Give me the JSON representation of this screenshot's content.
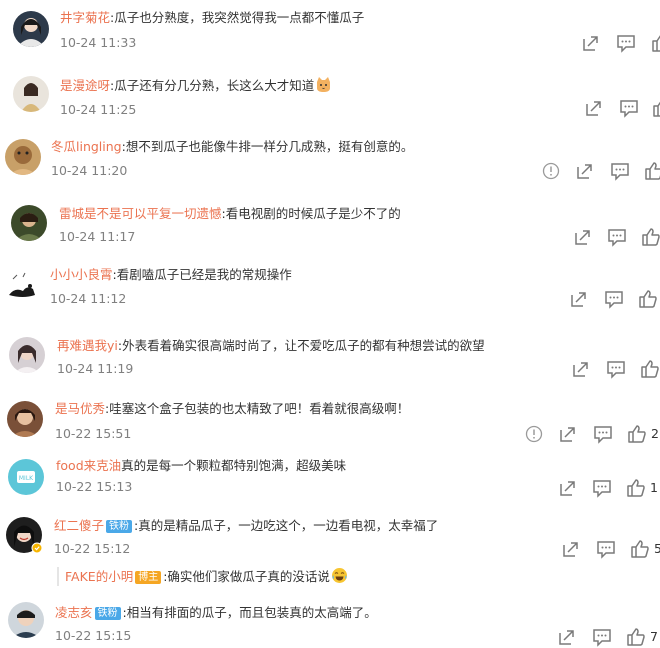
{
  "comments": [
    {
      "username": "井字菊花",
      "text": ":瓜子也分熟度，我突然觉得我一点都不懂瓜子",
      "time": "10-24 11:33",
      "emoji": ""
    },
    {
      "username": "是漫途呀",
      "text": ":瓜子还有分几分熟，长这么大才知道",
      "time": "10-24 11:25",
      "emoji": "cat-emoji"
    },
    {
      "username": "冬瓜lingling",
      "text": ":想不到瓜子也能像牛排一样分几成熟，挺有创意的。",
      "time": "10-24 11:20",
      "emoji": ""
    },
    {
      "username": "雷城是不是可以平复一切遗憾",
      "text": ":看电视剧的时候瓜子是少不了的",
      "time": "10-24 11:17",
      "emoji": ""
    },
    {
      "username": "小小小良霄",
      "text": ":看剧嗑瓜子已经是我的常规操作",
      "time": "10-24 11:12",
      "emoji": ""
    },
    {
      "username": "再难遇我yi",
      "text": ":外表看着确实很高端时尚了，让不爱吃瓜子的都有种想尝试的欲望",
      "time": "10-24 11:19",
      "emoji": ""
    },
    {
      "username": "是马优秀",
      "text": ":哇塞这个盒子包装的也太精致了吧！看着就很高级啊！",
      "time": "10-22 15:51",
      "likes": "2"
    },
    {
      "username": "food来克油",
      "text": "真的是每一个颗粒都特别饱满，超级美味",
      "time": "10-22 15:13",
      "likes": "1"
    },
    {
      "username": "红二傻子",
      "badge": "铁粉",
      "text": ":真的是精品瓜子，一边吃这个，一边看电视，太幸福了",
      "time": "10-22 15:12",
      "likes": "5"
    },
    {
      "username": "凌志亥",
      "badge": "铁粉",
      "text": ":相当有排面的瓜子，而且包装真的太高端了。",
      "time": "10-22 15:15",
      "likes": "7"
    }
  ],
  "reply": {
    "username": "FAKE的小明",
    "badge": "博主",
    "text": ":确实他们家做瓜子真的没话说",
    "emoji": "laugh-cry-emoji"
  },
  "colors": {
    "username": "#eb7350",
    "text": "#333333",
    "time": "#808080",
    "icon": "#7a7a7a",
    "fan_badge": "#4aa8e8",
    "host_badge": "#f5a623"
  }
}
